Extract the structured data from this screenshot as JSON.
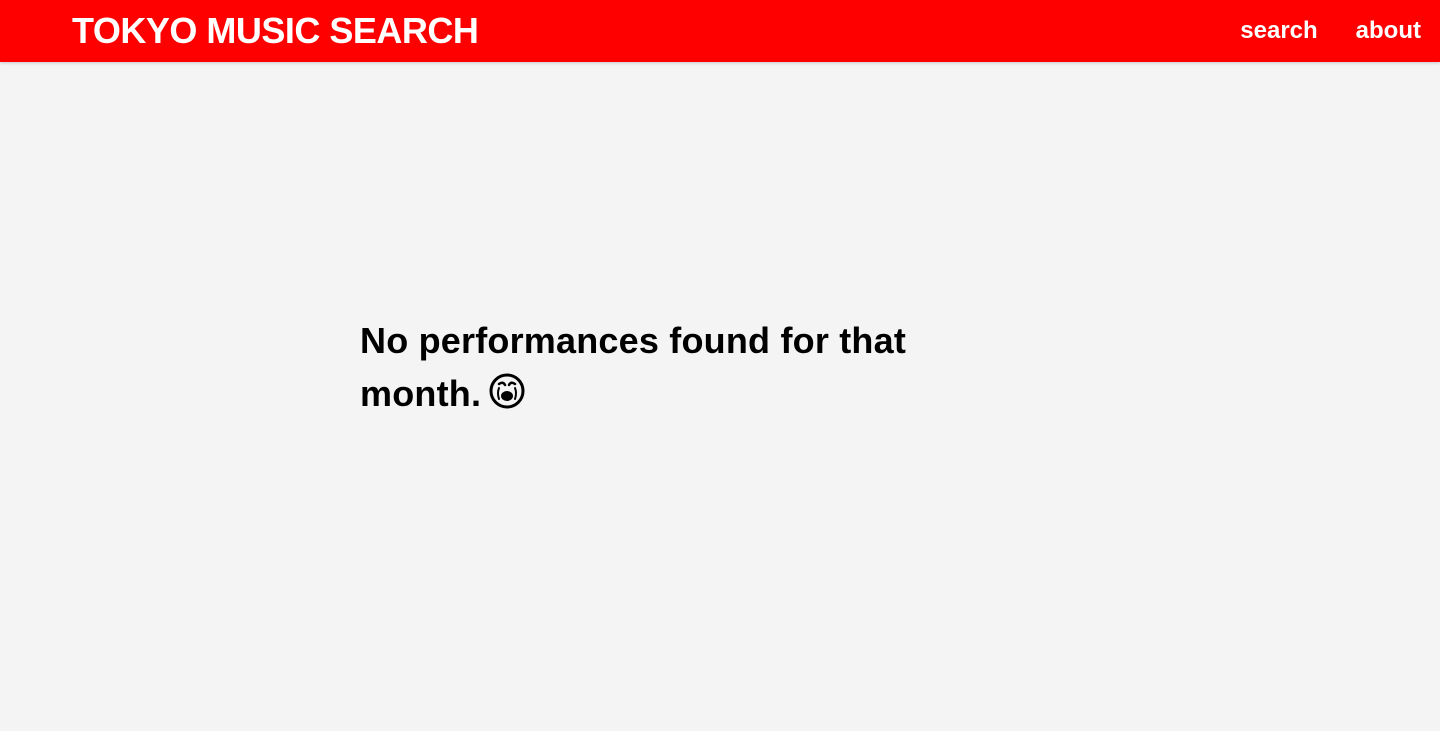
{
  "header": {
    "title": "TOKYO MUSIC SEARCH",
    "background_color": "#ff0000",
    "nav": [
      {
        "label": "search"
      },
      {
        "label": "about"
      }
    ]
  },
  "main": {
    "message": "No performances found for that month.",
    "emoji_icon": "crying-face-icon"
  },
  "colors": {
    "page_background": "#f4f4f4",
    "text": "#000000",
    "header_text": "#ffffff"
  }
}
